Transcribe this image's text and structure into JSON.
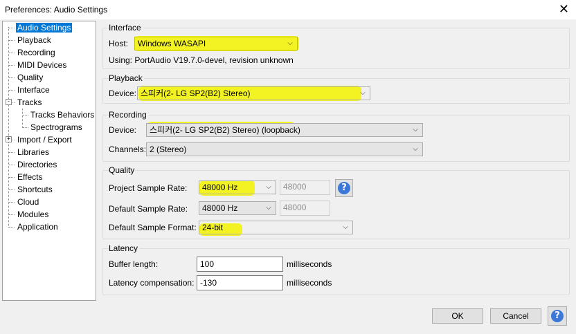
{
  "window": {
    "title": "Preferences: Audio Settings",
    "close_symbol": "✕"
  },
  "tree": {
    "items": [
      {
        "label": "Audio Settings",
        "selected": true
      },
      {
        "label": "Playback"
      },
      {
        "label": "Recording"
      },
      {
        "label": "MIDI Devices"
      },
      {
        "label": "Quality"
      },
      {
        "label": "Interface"
      },
      {
        "label": "Tracks",
        "expander": "-"
      },
      {
        "label": "Tracks Behaviors"
      },
      {
        "label": "Spectrograms"
      },
      {
        "label": "Import / Export",
        "expander": "+"
      },
      {
        "label": "Libraries"
      },
      {
        "label": "Directories"
      },
      {
        "label": "Effects"
      },
      {
        "label": "Shortcuts"
      },
      {
        "label": "Cloud"
      },
      {
        "label": "Modules"
      },
      {
        "label": "Application"
      }
    ]
  },
  "interface": {
    "title": "Interface",
    "host_label": "Host:",
    "host_value": "Windows WASAPI",
    "using_text": "Using: PortAudio V19.7.0-devel, revision unknown"
  },
  "playback": {
    "title": "Playback",
    "device_label": "Device:",
    "device_value": "스피커(2- LG SP2(B2) Stereo)"
  },
  "recording": {
    "title": "Recording",
    "device_label": "Device:",
    "device_value": "스피커(2- LG SP2(B2) Stereo) (loopback)",
    "channels_label": "Channels:",
    "channels_value": "2 (Stereo)"
  },
  "quality": {
    "title": "Quality",
    "project_rate_label": "Project Sample Rate:",
    "project_rate_value": "48000 Hz",
    "project_rate_custom": "48000",
    "default_rate_label": "Default Sample Rate:",
    "default_rate_value": "48000 Hz",
    "default_rate_custom": "48000",
    "format_label": "Default Sample Format:",
    "format_value": "24-bit"
  },
  "latency": {
    "title": "Latency",
    "buffer_label": "Buffer length:",
    "buffer_value": "100",
    "buffer_unit": "milliseconds",
    "comp_label": "Latency compensation:",
    "comp_value": "-130",
    "comp_unit": "milliseconds"
  },
  "buttons": {
    "ok": "OK",
    "cancel": "Cancel",
    "help_symbol": "?"
  },
  "colors": {
    "selection": "#0078d7",
    "highlight": "#f3f300",
    "help": "#3b78d8"
  }
}
